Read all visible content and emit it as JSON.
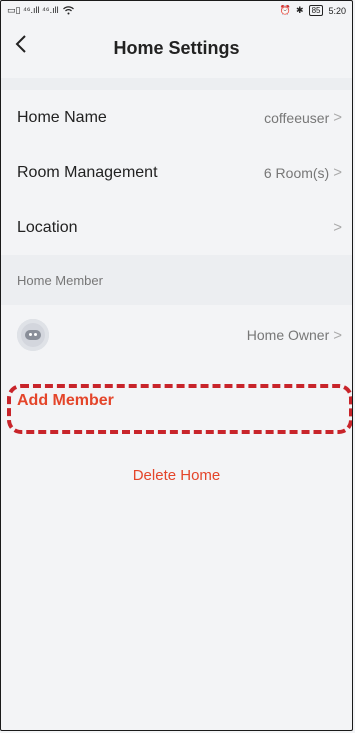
{
  "status_bar": {
    "time": "5:20",
    "battery": "85",
    "network_left": "▭▯ ⁴⁶.ıll ⁴⁶.ıll",
    "wifi_icon": "wifi-icon",
    "alarm_icon": "alarm-icon",
    "bluetooth_icon": "bluetooth-icon"
  },
  "header": {
    "title": "Home Settings",
    "back_icon": "chevron-left-icon"
  },
  "settings": [
    {
      "label": "Home Name",
      "value": "coffeeuser"
    },
    {
      "label": "Room Management",
      "value": "6 Room(s)"
    },
    {
      "label": "Location",
      "value": ""
    }
  ],
  "member_section": {
    "title": "Home Member",
    "member_role": "Home Owner",
    "add_label": "Add Member"
  },
  "delete_label": "Delete Home",
  "colors": {
    "accent": "#e4452a",
    "highlight": "#c8242a"
  }
}
